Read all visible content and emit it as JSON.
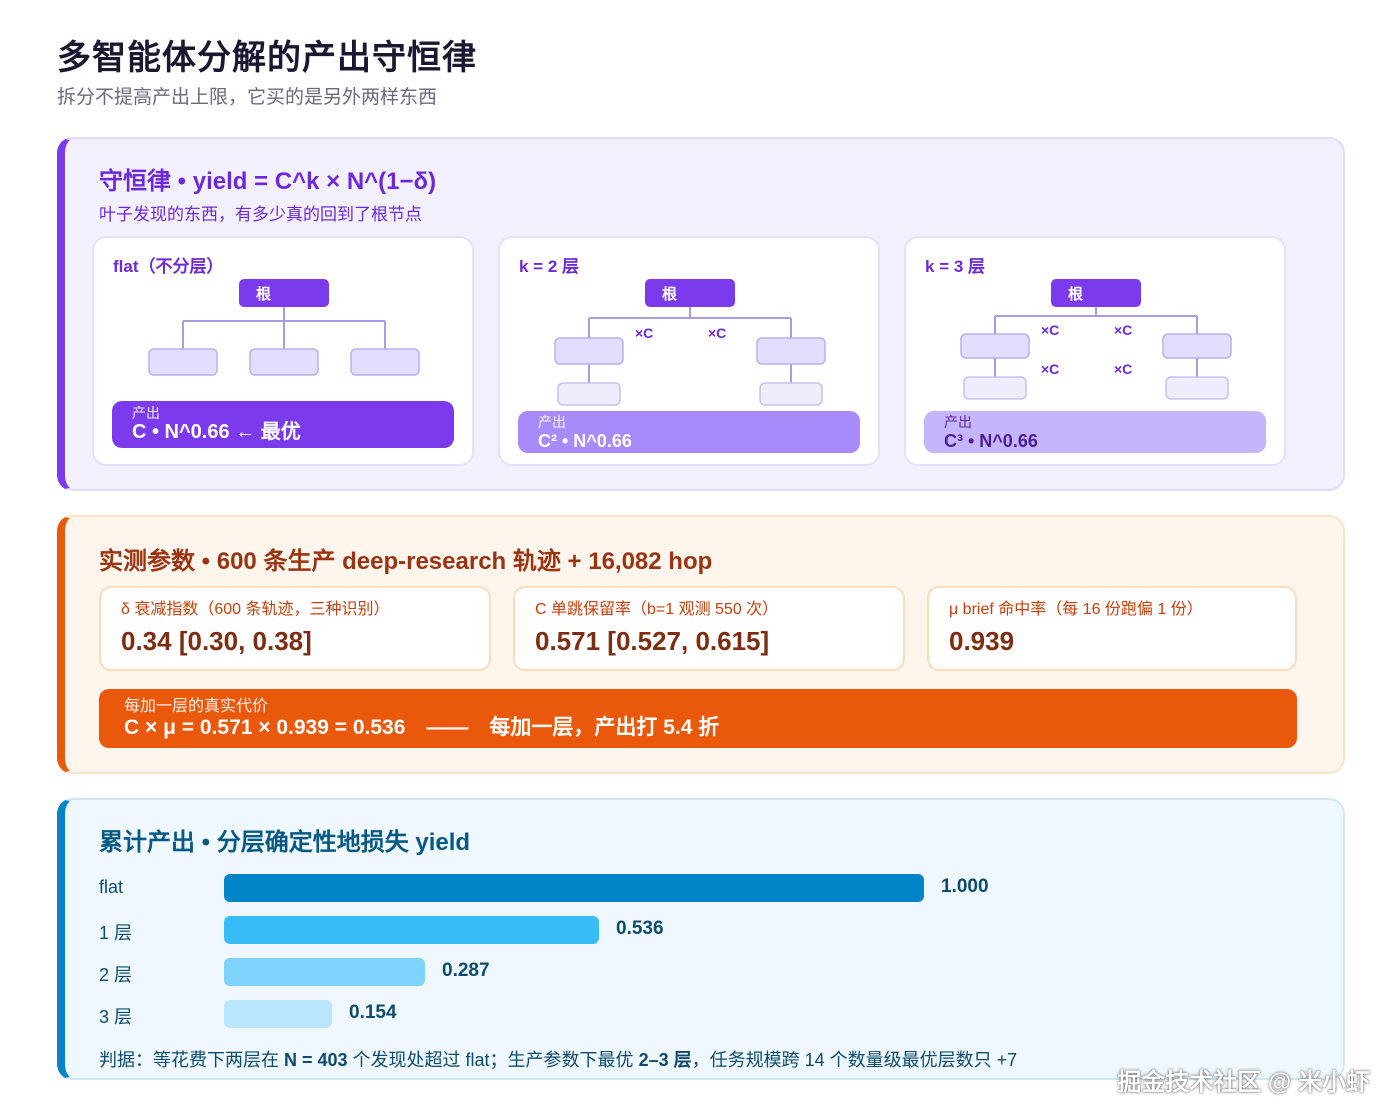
{
  "header": {
    "title": "多智能体分解的产出守恒律",
    "subtitle": "拆分不提高产出上限，它买的是另外两样东西"
  },
  "law": {
    "title": "守恒律 • yield = C^k × N^(1−δ)",
    "subtitle": "叶子发现的东西，有多少真的回到了根节点",
    "root_label": "根",
    "mult_label": "×C",
    "cards": [
      {
        "label": "flat（不分层）",
        "yield_small": "产出",
        "yield_big": "C • N^0.66 ← 最优"
      },
      {
        "label": "k = 2 层",
        "yield_small": "产出",
        "yield_big": "C² • N^0.66"
      },
      {
        "label": "k = 3 层",
        "yield_small": "产出",
        "yield_big": "C³ • N^0.66"
      }
    ]
  },
  "params": {
    "title": "实测参数 • 600 条生产 deep-research 轨迹 + 16,082 hop",
    "cards": [
      {
        "label": "δ 衰减指数（600 条轨迹，三种识别）",
        "value": "0.34 [0.30, 0.38]"
      },
      {
        "label": "C 单跳保留率（b=1 观测 550 次）",
        "value": "0.571 [0.527, 0.615]"
      },
      {
        "label": "μ brief 命中率（每 16 份跑偏 1 份）",
        "value": "0.939"
      }
    ],
    "cost": {
      "small": "每加一层的真实代价",
      "big": "C × μ = 0.571 × 0.939 = 0.536　——　每加一层，产出打 5.4 折"
    }
  },
  "cumulative": {
    "title": "累计产出 • 分层确定性地损失 yield",
    "verdict_parts": {
      "a": "判据：等花费下两层在 ",
      "b": "N = 403",
      "c": " 个发现处超过 flat；生产参数下最优 ",
      "d": "2–3 层",
      "e": "，任务规模跨 14 个数量级最优层数只 +7"
    }
  },
  "chart_data": {
    "type": "bar",
    "orientation": "horizontal",
    "title": "累计产出 • 分层确定性地损失 yield",
    "categories": [
      "flat",
      "1 层",
      "2 层",
      "3 层"
    ],
    "values": [
      1.0,
      0.536,
      0.287,
      0.154
    ],
    "value_labels": [
      "1.000",
      "0.536",
      "0.287",
      "0.154"
    ],
    "colors": [
      "#0284c7",
      "#38bdf8",
      "#7dd3fc",
      "#bae6fd"
    ],
    "xlim": [
      0,
      1
    ]
  },
  "watermark": "掘金技术社区 @ 米小虾",
  "colors": {
    "purple": "#7c3aed",
    "orange": "#ea580c",
    "blue": "#0284c7"
  }
}
